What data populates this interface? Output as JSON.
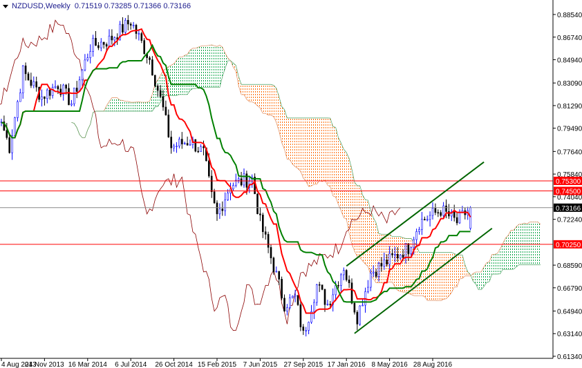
{
  "header": {
    "symbol": "NZDUSD,Weekly",
    "ohlc": "0.71519 0.73285 0.71366 0.73166"
  },
  "chart_data": {
    "type": "candlestick",
    "title": "NZDUSD,Weekly",
    "ylim": [
      0.6134,
      0.8854
    ],
    "y_ticks": [
      "0.88540",
      "0.86740",
      "0.84940",
      "0.83090",
      "0.81290",
      "0.79490",
      "0.77640",
      "0.75840",
      "0.74040",
      "0.72240",
      "0.68590",
      "0.66790",
      "0.64940",
      "0.63140",
      "0.61340"
    ],
    "x_ticks": [
      "4 Aug 2013",
      "24 Nov 2013",
      "16 Mar 2014",
      "6 Jul 2014",
      "26 Oct 2014",
      "15 Feb 2015",
      "7 Jun 2015",
      "27 Sep 2015",
      "17 Jan 2016",
      "8 May 2016",
      "28 Aug 2016"
    ],
    "weeks_per_tick": 16,
    "close_anchors": [
      [
        0,
        0.8
      ],
      [
        3,
        0.78
      ],
      [
        8,
        0.84
      ],
      [
        15,
        0.82
      ],
      [
        21,
        0.83
      ],
      [
        26,
        0.815
      ],
      [
        33,
        0.86
      ],
      [
        40,
        0.865
      ],
      [
        48,
        0.88
      ],
      [
        55,
        0.85
      ],
      [
        60,
        0.81
      ],
      [
        63,
        0.78
      ],
      [
        70,
        0.785
      ],
      [
        75,
        0.775
      ],
      [
        78,
        0.74
      ],
      [
        80,
        0.725
      ],
      [
        85,
        0.75
      ],
      [
        93,
        0.755
      ],
      [
        96,
        0.72
      ],
      [
        101,
        0.685
      ],
      [
        105,
        0.655
      ],
      [
        109,
        0.66
      ],
      [
        112,
        0.63
      ],
      [
        117,
        0.67
      ],
      [
        121,
        0.655
      ],
      [
        127,
        0.685
      ],
      [
        130,
        0.66
      ],
      [
        132,
        0.645
      ],
      [
        137,
        0.68
      ],
      [
        144,
        0.69
      ],
      [
        151,
        0.7
      ],
      [
        155,
        0.72
      ],
      [
        163,
        0.73
      ],
      [
        169,
        0.72
      ],
      [
        174,
        0.7317
      ]
    ],
    "last_candle": {
      "open": 0.71519,
      "high": 0.73285,
      "low": 0.71366,
      "close": 0.73166
    },
    "levels": [
      {
        "label": "0.75300",
        "value": 0.753,
        "color": "#ff0000"
      },
      {
        "label": "0.74500",
        "value": 0.745,
        "color": "#ff0000"
      },
      {
        "label": "0.70250",
        "value": 0.7025,
        "color": "#ff0000"
      }
    ],
    "current_price": {
      "label": "0.73166",
      "value": 0.73166
    },
    "channel": {
      "upper": [
        [
          128,
          0.6852
        ],
        [
          179,
          0.768
        ]
      ],
      "lower": [
        [
          131,
          0.6316
        ],
        [
          182,
          0.7152
        ]
      ],
      "color": "#006400"
    },
    "indicators": [
      "Ichimoku (Tenkan red, Kijun green, Chikou brown, Kumo orange/green)"
    ],
    "colors": {
      "bull": "#0000ff",
      "bear": "#000000",
      "tenkan": "#ff0000",
      "kijun": "#008000",
      "chikou": "#8b0000",
      "cloud_bear": "#ff6a00",
      "cloud_bull": "#00a040"
    }
  }
}
